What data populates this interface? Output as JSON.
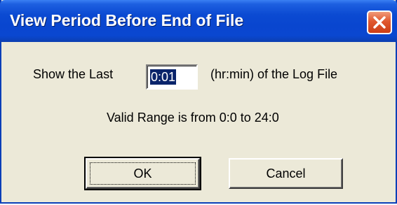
{
  "dialog": {
    "title": "View Period Before End of File",
    "close_icon": "close-icon",
    "prompt_prefix": "Show the Last",
    "time_value": "0:01",
    "prompt_suffix": "(hr:min) of the Log File",
    "range_note": "Valid Range is from 0:0 to 24:0",
    "ok_label": "OK",
    "cancel_label": "Cancel"
  },
  "colors": {
    "titlebar": "#0b4ad2",
    "close_button": "#e0582f",
    "dialog_bg": "#ece9d8",
    "selection": "#0a246a"
  }
}
